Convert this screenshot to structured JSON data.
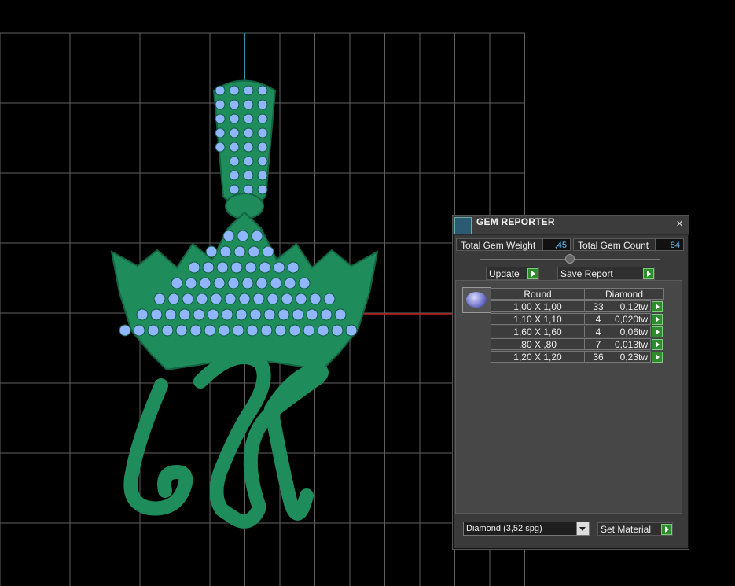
{
  "viewport": {
    "grid_color": "#5f5f5f",
    "model_green": "#1f8c5b",
    "gem_blue": "#8fb6ff"
  },
  "panel": {
    "title": "GEM REPORTER",
    "close_symbol": "✕",
    "total_weight_label": "Total Gem Weight",
    "total_weight_value": ",45",
    "total_count_label": "Total Gem Count",
    "total_count_value": "84",
    "update_label": "Update",
    "save_report_label": "Save Report",
    "table": {
      "shape": "Round",
      "material": "Diamond",
      "rows": [
        {
          "size": "1,00 X 1,00",
          "count": "33",
          "weight": "0,12tw"
        },
        {
          "size": "1,10 X 1,10",
          "count": "4",
          "weight": "0,020tw"
        },
        {
          "size": "1,60 X 1,60",
          "count": "4",
          "weight": "0,06tw"
        },
        {
          "size": ",80 X ,80",
          "count": "7",
          "weight": "0,013tw"
        },
        {
          "size": "1,20 X 1,20",
          "count": "36",
          "weight": "0,23tw"
        }
      ]
    },
    "material_select_value": "Diamond    (3,52 spg)",
    "set_material_label": "Set Material"
  }
}
